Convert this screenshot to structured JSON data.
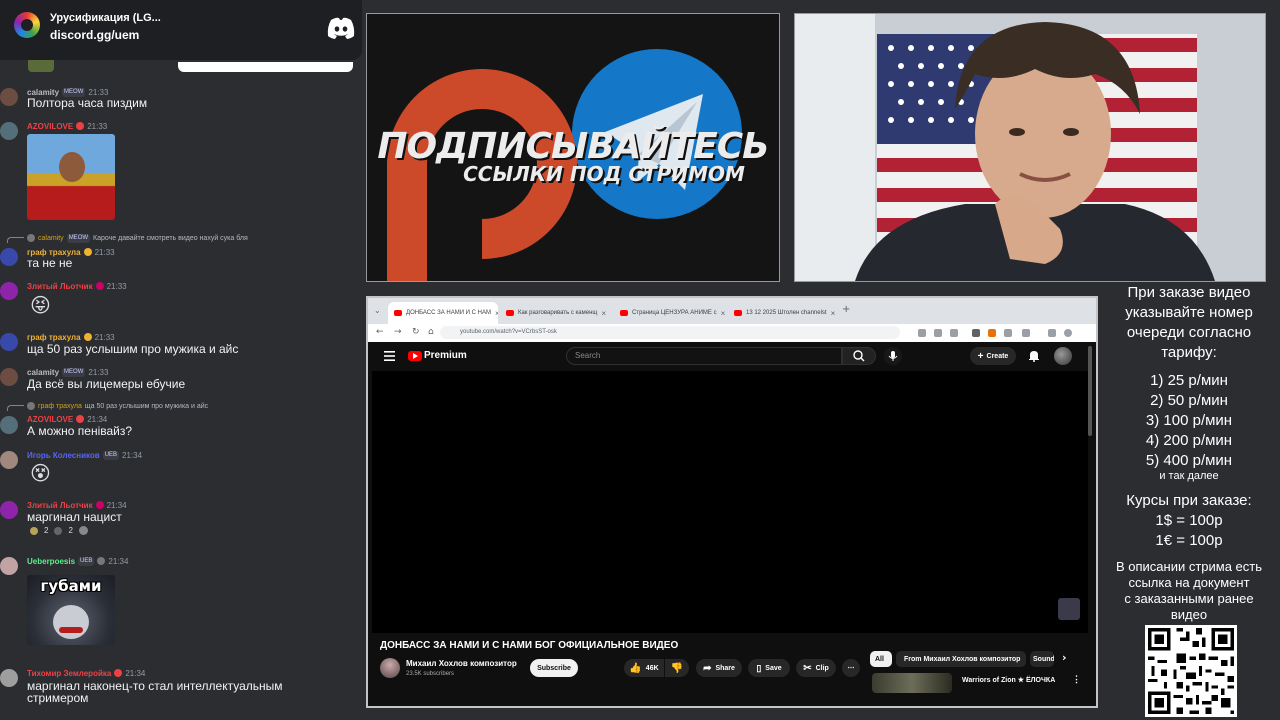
{
  "discord_widget": {
    "server_name": "Урусификация (LG...",
    "invite": "discord.gg/uem"
  },
  "chat": {
    "messages": [
      {
        "user": "calamity",
        "badge": "MEOW",
        "time": "21:33",
        "text": "Полтора часа пиздим",
        "color": "#b9bbbe"
      },
      {
        "user": "AZOVILOVE",
        "time": "21:33",
        "text": "",
        "color": "#ed4245",
        "image": "photo"
      },
      {
        "reply": {
          "user": "calamity",
          "badge": "MEOW",
          "text": "Карочe давайте смотреть видео нахуй сука бля"
        },
        "user": "граф трахула",
        "time": "21:33",
        "text": "та не не",
        "color": "#f0b232"
      },
      {
        "user": "Злитый Льотчик",
        "time": "21:33",
        "text": "",
        "emoji": "😝",
        "color": "#ed4245"
      },
      {
        "user": "граф трахула",
        "time": "21:33",
        "text": "ща 50 раз услышим про мужика и айс",
        "color": "#f0b232"
      },
      {
        "user": "calamity",
        "badge": "MEOW",
        "time": "21:33",
        "text": "Да всё вы лицемеры ебучие",
        "color": "#b9bbbe"
      },
      {
        "reply": {
          "user": "граф трахула",
          "text": "ща 50 раз услышим про мужика и айс"
        },
        "user": "AZOVILOVE",
        "time": "21:34",
        "text": "А можно пенівайз?",
        "color": "#ed4245"
      },
      {
        "user": "Игорь Колесников",
        "badge": "UEB",
        "time": "21:34",
        "text": "",
        "emoji": "😵",
        "color": "#5865f2"
      },
      {
        "user": "Злитый Льотчик",
        "time": "21:34",
        "text": "маргинал нацист",
        "color": "#ed4245",
        "reactions": [
          "2",
          "2"
        ]
      },
      {
        "user": "Ueberpoesis",
        "badge": "UEB",
        "time": "21:34",
        "text": "",
        "color": "#57f287",
        "image": "губами"
      },
      {
        "user": "Тихомир Землеройка",
        "time": "21:34",
        "text": "маргинал наконец-то стал интеллектуальным",
        "text2": "стримером",
        "color": "#ed4245"
      }
    ]
  },
  "banner": {
    "title": "ПОДПИСЫВАЙТЕСЬ",
    "subtitle": "ССЫЛКИ ПОД СТРИМОМ"
  },
  "browser": {
    "tabs": [
      {
        "label": "ДОНБАСС ЗА НАМИ И С НАМ",
        "active": true
      },
      {
        "label": "Как разговаривать с каменщ",
        "active": false
      },
      {
        "label": "Страница ЦЕНЗУРА АНИМЕ с",
        "active": false
      },
      {
        "label": "13 12 2025 Штолен channelst",
        "active": false
      }
    ],
    "url": "youtube.com/watch?v=VCrbsST-osk"
  },
  "youtube": {
    "logo_text": "Premium",
    "search_placeholder": "Search",
    "create_label": "Create",
    "video_title": "ДОНБАСС ЗА НАМИ И С НАМИ БОГ ОФИЦИАЛЬНОЕ ВИДЕО",
    "channel_name": "Михаил Хохлов  композитор",
    "subscribers": "23.5K subscribers",
    "subscribe_label": "Subscribe",
    "likes": "46K",
    "share_label": "Share",
    "save_label": "Save",
    "clip_label": "Clip",
    "chips": [
      "All",
      "From Михаил Хохлов композитор",
      "Sound"
    ],
    "recommendation_title": "Warriors of Zion ★ ЁЛОЧКА"
  },
  "order_info": {
    "heading": [
      "При заказе видео",
      "указывайте номер",
      "очереди согласно",
      "тарифу:"
    ],
    "tariffs": [
      "1) 25 р/мин",
      "2) 50 р/мин",
      "3) 100 р/мин",
      "4) 200 р/мин",
      "5) 400 р/мин"
    ],
    "etc": "и так далее",
    "rates_heading": "Курсы при заказе:",
    "rates": [
      "1$ = 100р",
      "1€ = 100р"
    ],
    "description": [
      "В описании стрима есть",
      "ссылка на документ",
      "с заказанными ранее",
      "видео"
    ]
  }
}
